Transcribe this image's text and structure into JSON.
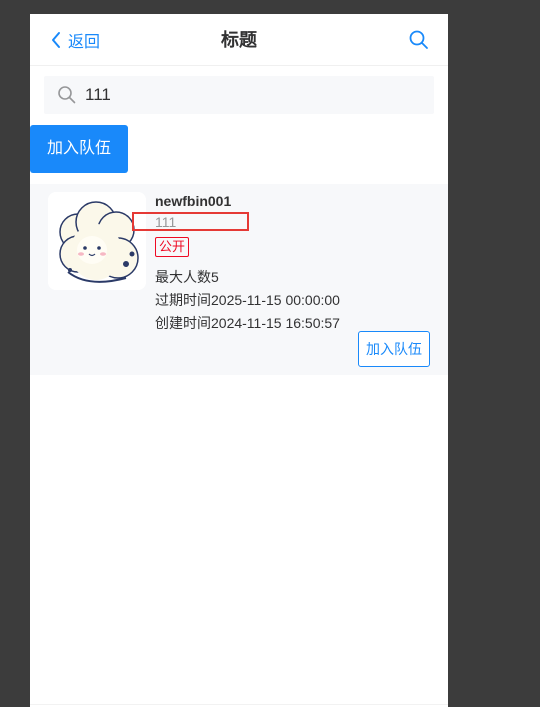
{
  "navbar": {
    "back_label": "返回",
    "title": "标题"
  },
  "search": {
    "value": "111",
    "placeholder": ""
  },
  "join_button_label": "加入队伍",
  "team": {
    "name": "newfbin001",
    "description": "111",
    "status_tag": "公开",
    "max_members": "最大人数5",
    "expire_time": "过期时间2025-11-15 00:00:00",
    "create_time": "创建时间2024-11-15 16:50:57",
    "join_label": "加入队伍"
  },
  "colors": {
    "primary": "#1989fa",
    "danger": "#ee0a24",
    "annotation": "#e53935"
  }
}
